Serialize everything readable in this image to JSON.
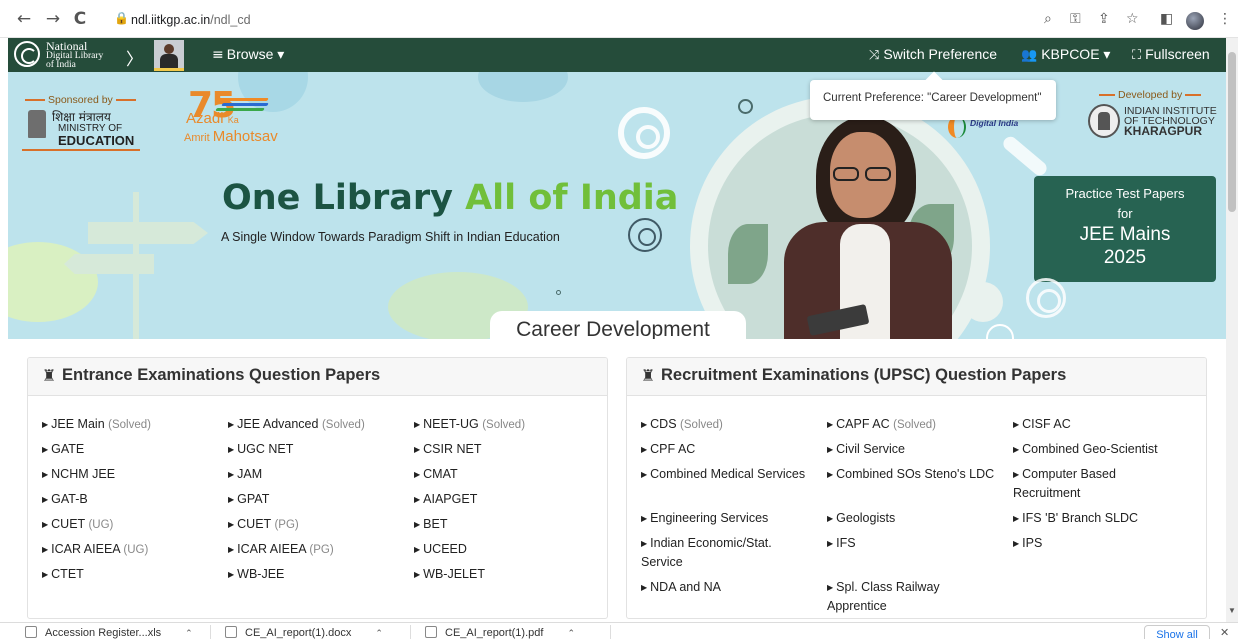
{
  "browser": {
    "back_icon": "←",
    "forward_icon": "→",
    "reload_icon": "C",
    "url_host": "ndl.iitkgp.ac.in",
    "url_path": "/ndl_cd",
    "icons": {
      "zoom": "⌕",
      "key": "⚿",
      "share": "⇪",
      "star": "☆",
      "sidepanel": "◧",
      "menu": "⋮"
    }
  },
  "navbar": {
    "logo_line1": "National",
    "logo_line2": "Digital Library",
    "logo_line3": "of India",
    "chevron": "〉",
    "browse_icon": "≡",
    "browse_label": "Browse ▾",
    "switch_icon": "⤨",
    "switch_label": "Switch Preference",
    "user_icon": "👥",
    "user_label": "KBPCOE ▾",
    "fullscreen_icon": "⛶",
    "fullscreen_label": "Fullscreen"
  },
  "tooltip": {
    "text": "Current Preference: \"Career Development\""
  },
  "banner": {
    "sponsored_by": "Sponsored by",
    "moe_hindi": "शिक्षा मंत्रालय",
    "moe_ministry": "MINISTRY OF",
    "moe_education": "EDUCATION",
    "azadi_num": "75",
    "azadi_word": "Azadi",
    "azadi_ka": "Ka",
    "amrit_word": "Amrit",
    "mahotsav_word": "Mahotsav",
    "headline_part1": "One Library ",
    "headline_part2": "All of India",
    "subline": "A Single Window Towards Paradigm Shift in Indian Education",
    "digital_india": "Digital India",
    "developed_by": "Developed by",
    "iit_line1": "INDIAN INSTITUTE",
    "iit_line2": "OF TECHNOLOGY",
    "iit_line3": "KHARAGPUR",
    "practice_l1": "Practice Test Papers",
    "practice_l2": "for",
    "practice_l3": "JEE Mains",
    "practice_l4": "2025",
    "section_title": "Career Development"
  },
  "entrance_panel": {
    "icon": "♜",
    "title": "Entrance Examinations Question Papers",
    "items": [
      {
        "label": "JEE Main",
        "note": "(Solved)"
      },
      {
        "label": "JEE Advanced",
        "note": "(Solved)"
      },
      {
        "label": "NEET-UG",
        "note": "(Solved)"
      },
      {
        "label": "GATE",
        "note": ""
      },
      {
        "label": "UGC NET",
        "note": ""
      },
      {
        "label": "CSIR NET",
        "note": ""
      },
      {
        "label": "NCHM JEE",
        "note": ""
      },
      {
        "label": "JAM",
        "note": ""
      },
      {
        "label": "CMAT",
        "note": ""
      },
      {
        "label": "GAT-B",
        "note": ""
      },
      {
        "label": "GPAT",
        "note": ""
      },
      {
        "label": "AIAPGET",
        "note": ""
      },
      {
        "label": "CUET",
        "note": "(UG)"
      },
      {
        "label": "CUET",
        "note": "(PG)"
      },
      {
        "label": "BET",
        "note": ""
      },
      {
        "label": "ICAR AIEEA",
        "note": "(UG)"
      },
      {
        "label": "ICAR AIEEA",
        "note": "(PG)"
      },
      {
        "label": "UCEED",
        "note": ""
      },
      {
        "label": "CTET",
        "note": ""
      },
      {
        "label": "WB-JEE",
        "note": ""
      },
      {
        "label": "WB-JELET",
        "note": ""
      }
    ]
  },
  "recruitment_panel": {
    "icon": "♜",
    "title": "Recruitment Examinations (UPSC) Question Papers",
    "items": [
      {
        "label": "CDS",
        "note": "(Solved)"
      },
      {
        "label": "CAPF AC",
        "note": "(Solved)"
      },
      {
        "label": "CISF AC",
        "note": ""
      },
      {
        "label": "CPF AC",
        "note": ""
      },
      {
        "label": "Civil Service",
        "note": ""
      },
      {
        "label": "Combined Geo-Scientist",
        "note": ""
      },
      {
        "label": "Combined Medical Services",
        "note": ""
      },
      {
        "label": "Combined SOs Steno's LDC",
        "note": ""
      },
      {
        "label": "Computer Based",
        "label2": "Recruitment",
        "note": ""
      },
      {
        "label": "Engineering Services",
        "note": ""
      },
      {
        "label": "Geologists",
        "note": ""
      },
      {
        "label": "IFS 'B' Branch SLDC",
        "note": ""
      },
      {
        "label": "Indian Economic/Stat.",
        "label2": "Service",
        "note": ""
      },
      {
        "label": "IFS",
        "note": ""
      },
      {
        "label": "IPS",
        "note": ""
      },
      {
        "label": "NDA and NA",
        "note": ""
      },
      {
        "label": "Spl. Class Railway",
        "label2": "Apprentice",
        "note": ""
      }
    ]
  },
  "downloads": {
    "items": [
      {
        "name": "Accession Register...xls"
      },
      {
        "name": "CE_AI_report(1).docx"
      },
      {
        "name": "CE_AI_report(1).pdf"
      }
    ],
    "show_all": "Show all",
    "close_icon": "✕",
    "chevron_icon": "⌃"
  }
}
